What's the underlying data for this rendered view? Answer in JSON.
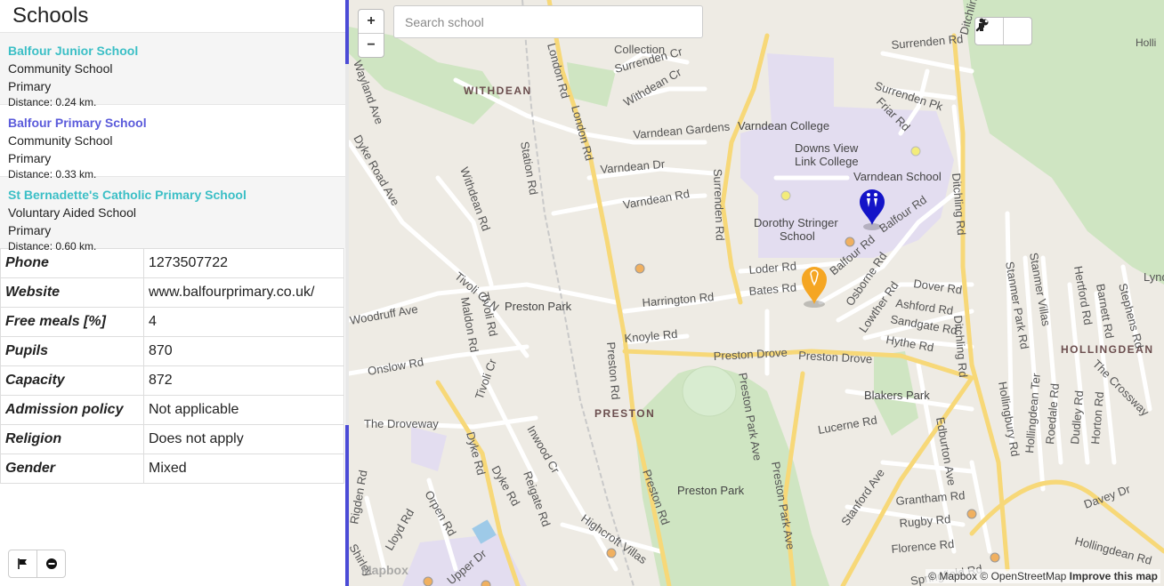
{
  "sidebar": {
    "title": "Schools",
    "schools": [
      {
        "name": "Balfour Junior School",
        "type": "Community School",
        "phase": "Primary",
        "distance": "Distance: 0.24 km."
      },
      {
        "name": "Balfour Primary School",
        "type": "Community School",
        "phase": "Primary",
        "distance": "Distance: 0.33 km."
      },
      {
        "name": "St Bernadette's Catholic Primary School",
        "type": "Voluntary Aided School",
        "phase": "Primary",
        "distance": "Distance: 0.60 km."
      }
    ],
    "details": [
      {
        "key": "Phone",
        "value": "1273507722"
      },
      {
        "key": "Website",
        "value": "www.balfourprimary.co.uk/"
      },
      {
        "key": "Free meals [%]",
        "value": "4"
      },
      {
        "key": "Pupils",
        "value": "870"
      },
      {
        "key": "Capacity",
        "value": "872"
      },
      {
        "key": "Admission policy",
        "value": "Not applicable"
      },
      {
        "key": "Religion",
        "value": "Does not apply"
      },
      {
        "key": "Gender",
        "value": "Mixed"
      }
    ],
    "buttons": {
      "flag": "flag-icon",
      "remove": "minus-circle-icon"
    }
  },
  "map": {
    "zoom_in": "+",
    "zoom_out": "−",
    "search_placeholder": "Search school",
    "tools": {
      "person": "person-icon",
      "wrench": "wrench-icon"
    },
    "attribution": {
      "mapbox": "© Mapbox",
      "osm": "© OpenStreetMap",
      "improve": "Improve this map"
    },
    "logo": "Mapbox",
    "labels": {
      "withdean": "WITHDEAN",
      "preston": "PRESTON",
      "hollingdean": "HOLLINGDEAN",
      "varndean_college": "Varndean College",
      "downs_view_1": "Downs View",
      "downs_view_2": "Link College",
      "varndean_school": "Varndean School",
      "dorothy_1": "Dorothy Stringer",
      "dorothy_2": "School",
      "preston_park_station": "Preston Park",
      "preston_park": "Preston Park",
      "blakers_park": "Blakers Park",
      "collection": "Collection",
      "surrenden_rd": "Surrenden Rd",
      "surrenden_rd_v": "Surrenden Rd",
      "surrenden_cr": "Surrenden Cr",
      "surrenden_pk": "Surrenden Pk",
      "withdean_cr": "Withdean Cr",
      "varndean_gardens": "Varndean Gardens",
      "varndean_dr": "Varndean Dr",
      "varndean_rd": "Varndean Rd",
      "london_rd_1": "London Rd",
      "london_rd_2": "London Rd",
      "station_rd": "Station Rd",
      "withdean_rd": "Withdean Rd",
      "dyke_road_ave": "Dyke Road Ave",
      "wayland_ave": "Wayland Ave",
      "tivoli_cr_n": "Tivoli Cr N",
      "tivoli_rd": "Tivoli Rd",
      "tivoli_cr": "Tivoli Cr",
      "maldon_rd": "Maldon Rd",
      "woodruff_ave": "Woodruff Ave",
      "onslow_rd": "Onslow Rd",
      "the_droveway": "The Droveway",
      "dyke_rd_1": "Dyke Rd",
      "dyke_rd_2": "Dyke Rd",
      "inwood_cr": "Inwood Cr",
      "reigate_rd": "Reigate Rd",
      "orpen_rd": "Orpen Rd",
      "lloyd_rd": "Lloyd Rd",
      "rigden_rd": "Rigden Rd",
      "shirley": "Shirley",
      "upper_dr": "Upper Dr",
      "highcroft_villas": "Highcroft Villas",
      "preston_rd_1": "Preston Rd",
      "preston_rd_2": "Preston Rd",
      "preston_drove": "Preston Drove",
      "preston_drove_2": "Preston Drove",
      "preston_park_ave_1": "Preston Park Ave",
      "preston_park_ave_2": "Preston Park Ave",
      "harrington_rd": "Harrington Rd",
      "knoyle_rd": "Knoyle Rd",
      "loder_rd": "Loder Rd",
      "bates_rd": "Bates Rd",
      "balfour_rd_1": "Balfour Rd",
      "balfour_rd_2": "Balfour Rd",
      "osborne_rd": "Osborne Rd",
      "dover_rd": "Dover Rd",
      "ashford_rd": "Ashford Rd",
      "lowther_rd": "Lowther Rd",
      "sandgate_rd": "Sandgate Rd",
      "hythe_rd": "Hythe Rd",
      "friar_rd": "Friar Rd",
      "ditchling_rd_1": "Ditchling Rd",
      "ditchling_rd_2": "Ditchling Rd",
      "ditchling_rd_3": "Ditchling Rd",
      "lucerne_rd": "Lucerne Rd",
      "edburton_ave": "Edburton Ave",
      "stanford_ave": "Stanford Ave",
      "grantham_rd": "Grantham Rd",
      "rugby_rd": "Rugby Rd",
      "florence_rd": "Florence Rd",
      "springfield_rd": "Springfield Rd",
      "stanmer_villas": "Stanmer Villas",
      "stanmer_park_rd": "Stanmer Park Rd",
      "hertford_rd": "Hertford Rd",
      "barnett_rd": "Barnett Rd",
      "stephens_rd": "Stephens Rd",
      "the_crossway": "The Crossway",
      "hollingbury_rd": "Hollingbury Rd",
      "hollingdean_ter": "Hollingdean Ter",
      "roedale_rd": "Roedale Rd",
      "dudley_rd": "Dudley Rd",
      "horton_rd": "Horton Rd",
      "davey_dr": "Davey Dr",
      "hollingdean_rd": "Hollingdean Rd",
      "lynd": "Lynd",
      "holli_park": "Holli\nPark C"
    },
    "colors": {
      "selected_marker": "#1414c8",
      "nearby_marker": "#f5a623",
      "school_area": "#e3ddf0",
      "park": "#cfe5c2",
      "major_road": "#f7d878"
    }
  }
}
